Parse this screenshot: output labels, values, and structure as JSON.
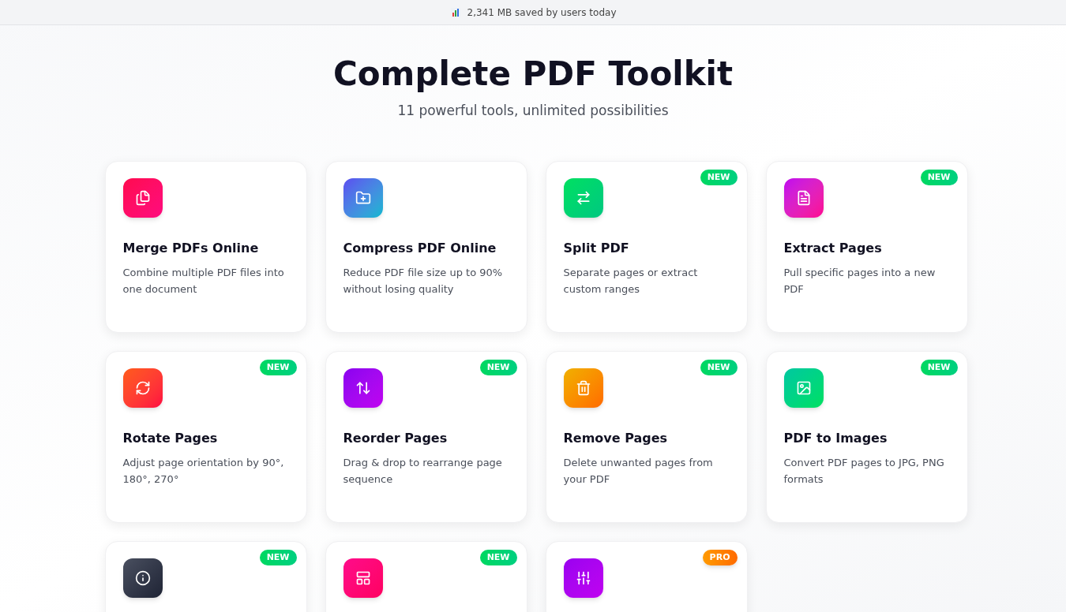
{
  "banner": {
    "text": "2,341 MB saved by users today"
  },
  "hero": {
    "title": "Complete PDF Toolkit",
    "subtitle": "11 powerful tools, unlimited possibilities"
  },
  "tools": [
    {
      "title": "Merge PDFs Online",
      "description": "Combine multiple PDF files into one document"
    },
    {
      "title": "Compress PDF Online",
      "description": "Reduce PDF file size up to 90% without losing quality"
    },
    {
      "title": "Split PDF",
      "description": "Separate pages or extract custom ranges",
      "badge": {
        "label": "NEW",
        "kind": "new"
      }
    },
    {
      "title": "Extract Pages",
      "description": "Pull specific pages into a new PDF",
      "badge": {
        "label": "NEW",
        "kind": "new"
      }
    },
    {
      "title": "Rotate Pages",
      "description": "Adjust page orientation by 90°, 180°, 270°",
      "badge": {
        "label": "NEW",
        "kind": "new"
      }
    },
    {
      "title": "Reorder Pages",
      "description": "Drag & drop to rearrange page sequence",
      "badge": {
        "label": "NEW",
        "kind": "new"
      }
    },
    {
      "title": "Remove Pages",
      "description": "Delete unwanted pages from your PDF",
      "badge": {
        "label": "NEW",
        "kind": "new"
      }
    },
    {
      "title": "PDF to Images",
      "description": "Convert PDF pages to JPG, PNG formats",
      "badge": {
        "label": "NEW",
        "kind": "new"
      }
    },
    {
      "badge": {
        "label": "NEW",
        "kind": "new"
      }
    },
    {
      "badge": {
        "label": "NEW",
        "kind": "new"
      }
    },
    {
      "badge": {
        "label": "PRO",
        "kind": "pro"
      }
    }
  ]
}
